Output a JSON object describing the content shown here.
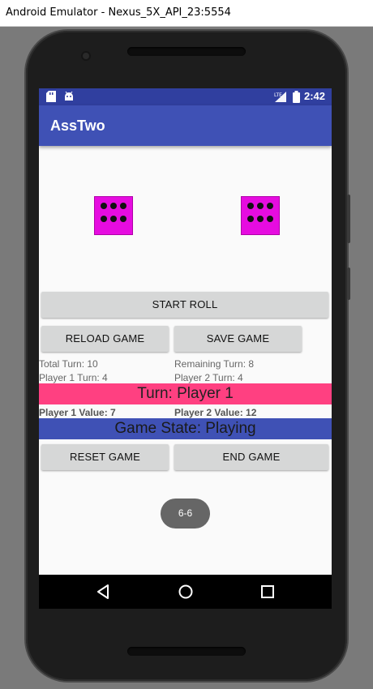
{
  "window": {
    "title": "Android Emulator - Nexus_5X_API_23:5554"
  },
  "statusbar": {
    "time": "2:42",
    "network": "LTE"
  },
  "appbar": {
    "title": "AssTwo"
  },
  "dice": [
    {
      "value": 6
    },
    {
      "value": 6
    }
  ],
  "buttons": {
    "start_roll": "START ROLL",
    "reload_game": "RELOAD GAME",
    "save_game": "SAVE GAME",
    "reset_game": "RESET GAME",
    "end_game": "END GAME"
  },
  "stats": {
    "total_turn": "Total Turn: 10",
    "remaining_turn": "Remaining Turn: 8",
    "player1_turn": "Player 1 Turn: 4",
    "player2_turn": "Player 2 Turn: 4",
    "player1_value": "Player 1 Value: 7",
    "player2_value": "Player 2 Value: 12"
  },
  "banners": {
    "turn": "Turn: Player 1",
    "game_state": "Game State: Playing"
  },
  "toast": {
    "text": "6-6"
  },
  "colors": {
    "primary": "#3f51b5",
    "primary_dark": "#303f9f",
    "accent": "#ff4081",
    "die": "#e60ce0"
  },
  "icons": {
    "status_left": [
      "sd-card-icon",
      "android-icon"
    ],
    "status_right": [
      "lte-signal-icon",
      "battery-icon"
    ],
    "nav": [
      "back-icon",
      "home-icon",
      "recents-icon"
    ]
  }
}
